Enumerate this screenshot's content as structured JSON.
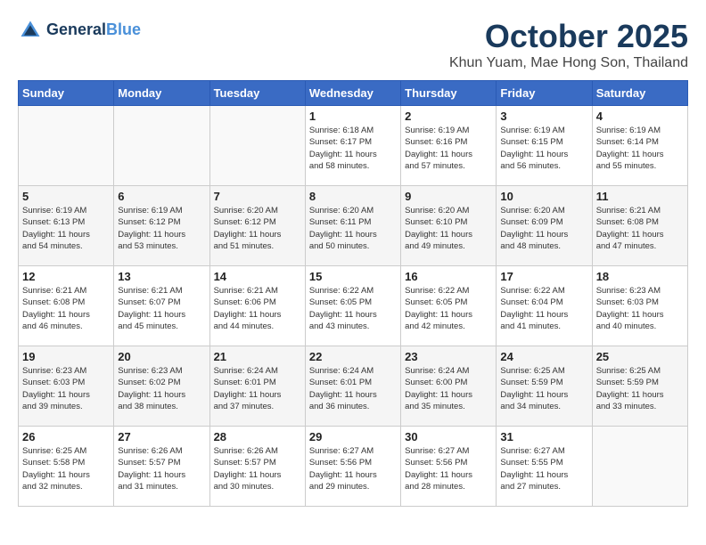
{
  "header": {
    "logo_line1": "General",
    "logo_line2": "Blue",
    "month": "October 2025",
    "location": "Khun Yuam, Mae Hong Son, Thailand"
  },
  "weekdays": [
    "Sunday",
    "Monday",
    "Tuesday",
    "Wednesday",
    "Thursday",
    "Friday",
    "Saturday"
  ],
  "weeks": [
    [
      {
        "day": "",
        "info": ""
      },
      {
        "day": "",
        "info": ""
      },
      {
        "day": "",
        "info": ""
      },
      {
        "day": "1",
        "info": "Sunrise: 6:18 AM\nSunset: 6:17 PM\nDaylight: 11 hours\nand 58 minutes."
      },
      {
        "day": "2",
        "info": "Sunrise: 6:19 AM\nSunset: 6:16 PM\nDaylight: 11 hours\nand 57 minutes."
      },
      {
        "day": "3",
        "info": "Sunrise: 6:19 AM\nSunset: 6:15 PM\nDaylight: 11 hours\nand 56 minutes."
      },
      {
        "day": "4",
        "info": "Sunrise: 6:19 AM\nSunset: 6:14 PM\nDaylight: 11 hours\nand 55 minutes."
      }
    ],
    [
      {
        "day": "5",
        "info": "Sunrise: 6:19 AM\nSunset: 6:13 PM\nDaylight: 11 hours\nand 54 minutes."
      },
      {
        "day": "6",
        "info": "Sunrise: 6:19 AM\nSunset: 6:12 PM\nDaylight: 11 hours\nand 53 minutes."
      },
      {
        "day": "7",
        "info": "Sunrise: 6:20 AM\nSunset: 6:12 PM\nDaylight: 11 hours\nand 51 minutes."
      },
      {
        "day": "8",
        "info": "Sunrise: 6:20 AM\nSunset: 6:11 PM\nDaylight: 11 hours\nand 50 minutes."
      },
      {
        "day": "9",
        "info": "Sunrise: 6:20 AM\nSunset: 6:10 PM\nDaylight: 11 hours\nand 49 minutes."
      },
      {
        "day": "10",
        "info": "Sunrise: 6:20 AM\nSunset: 6:09 PM\nDaylight: 11 hours\nand 48 minutes."
      },
      {
        "day": "11",
        "info": "Sunrise: 6:21 AM\nSunset: 6:08 PM\nDaylight: 11 hours\nand 47 minutes."
      }
    ],
    [
      {
        "day": "12",
        "info": "Sunrise: 6:21 AM\nSunset: 6:08 PM\nDaylight: 11 hours\nand 46 minutes."
      },
      {
        "day": "13",
        "info": "Sunrise: 6:21 AM\nSunset: 6:07 PM\nDaylight: 11 hours\nand 45 minutes."
      },
      {
        "day": "14",
        "info": "Sunrise: 6:21 AM\nSunset: 6:06 PM\nDaylight: 11 hours\nand 44 minutes."
      },
      {
        "day": "15",
        "info": "Sunrise: 6:22 AM\nSunset: 6:05 PM\nDaylight: 11 hours\nand 43 minutes."
      },
      {
        "day": "16",
        "info": "Sunrise: 6:22 AM\nSunset: 6:05 PM\nDaylight: 11 hours\nand 42 minutes."
      },
      {
        "day": "17",
        "info": "Sunrise: 6:22 AM\nSunset: 6:04 PM\nDaylight: 11 hours\nand 41 minutes."
      },
      {
        "day": "18",
        "info": "Sunrise: 6:23 AM\nSunset: 6:03 PM\nDaylight: 11 hours\nand 40 minutes."
      }
    ],
    [
      {
        "day": "19",
        "info": "Sunrise: 6:23 AM\nSunset: 6:03 PM\nDaylight: 11 hours\nand 39 minutes."
      },
      {
        "day": "20",
        "info": "Sunrise: 6:23 AM\nSunset: 6:02 PM\nDaylight: 11 hours\nand 38 minutes."
      },
      {
        "day": "21",
        "info": "Sunrise: 6:24 AM\nSunset: 6:01 PM\nDaylight: 11 hours\nand 37 minutes."
      },
      {
        "day": "22",
        "info": "Sunrise: 6:24 AM\nSunset: 6:01 PM\nDaylight: 11 hours\nand 36 minutes."
      },
      {
        "day": "23",
        "info": "Sunrise: 6:24 AM\nSunset: 6:00 PM\nDaylight: 11 hours\nand 35 minutes."
      },
      {
        "day": "24",
        "info": "Sunrise: 6:25 AM\nSunset: 5:59 PM\nDaylight: 11 hours\nand 34 minutes."
      },
      {
        "day": "25",
        "info": "Sunrise: 6:25 AM\nSunset: 5:59 PM\nDaylight: 11 hours\nand 33 minutes."
      }
    ],
    [
      {
        "day": "26",
        "info": "Sunrise: 6:25 AM\nSunset: 5:58 PM\nDaylight: 11 hours\nand 32 minutes."
      },
      {
        "day": "27",
        "info": "Sunrise: 6:26 AM\nSunset: 5:57 PM\nDaylight: 11 hours\nand 31 minutes."
      },
      {
        "day": "28",
        "info": "Sunrise: 6:26 AM\nSunset: 5:57 PM\nDaylight: 11 hours\nand 30 minutes."
      },
      {
        "day": "29",
        "info": "Sunrise: 6:27 AM\nSunset: 5:56 PM\nDaylight: 11 hours\nand 29 minutes."
      },
      {
        "day": "30",
        "info": "Sunrise: 6:27 AM\nSunset: 5:56 PM\nDaylight: 11 hours\nand 28 minutes."
      },
      {
        "day": "31",
        "info": "Sunrise: 6:27 AM\nSunset: 5:55 PM\nDaylight: 11 hours\nand 27 minutes."
      },
      {
        "day": "",
        "info": ""
      }
    ]
  ]
}
